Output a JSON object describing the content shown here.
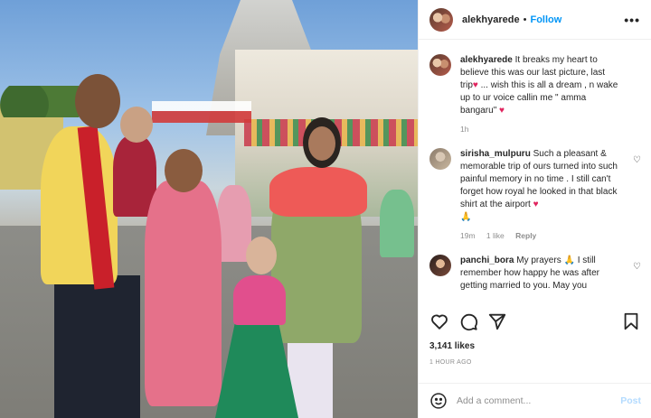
{
  "post": {
    "username": "alekhyarede",
    "follow_label": "Follow",
    "more_label": "•••",
    "likes": "3,141 likes",
    "time_ago": "1 HOUR AGO"
  },
  "comments": [
    {
      "user": "alekhyarede",
      "text_1": "It breaks my heart to believe this was our last picture, last trip",
      "text_2": "... wish this is all a dream , n wake up to ur voice callin me \" amma bangaru\"",
      "heart": "♥",
      "time": "1h",
      "likes": "",
      "reply": ""
    },
    {
      "user": "sirisha_mulpuru",
      "text": "Such a pleasant & memorable trip of ours turned into such painful memory in no time . I still can't forget how royal he looked in that black shirt at the airport",
      "heart": "♥",
      "extra": "🙏",
      "time": "19m",
      "likes": "1 like",
      "reply": "Reply"
    },
    {
      "user": "panchi_bora",
      "text_pre": "My prayers",
      "emoji": "🙏",
      "text": "I still remember how happy he was after getting married to you. May you"
    }
  ],
  "add_comment": {
    "placeholder": "Add a comment...",
    "post_label": "Post"
  }
}
